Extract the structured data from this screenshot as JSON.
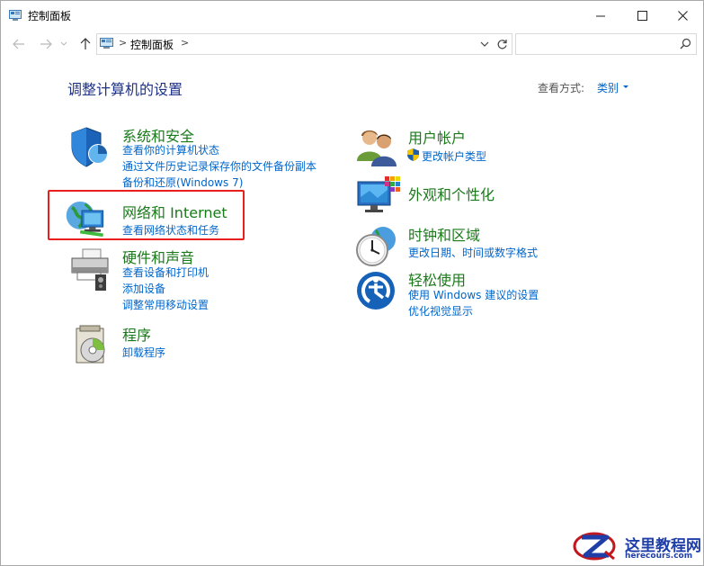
{
  "window": {
    "title": "控制面板",
    "minimize_icon": "minimize-icon",
    "maximize_icon": "maximize-icon",
    "close_icon": "close-icon"
  },
  "nav": {
    "back_icon": "arrow-left-icon",
    "forward_icon": "arrow-right-icon",
    "recent_icon": "chevron-down-icon",
    "up_icon": "arrow-up-icon"
  },
  "address": {
    "separator": ">",
    "path": "控制面板",
    "trailing_separator": ">"
  },
  "search": {
    "placeholder": "",
    "icon": "search-icon"
  },
  "main": {
    "heading": "调整计算机的设置",
    "view_by_label": "查看方式:",
    "view_by_value": "类别"
  },
  "categories_left": [
    {
      "title": "系统和安全",
      "icon": "shield-pie-icon",
      "links": [
        "查看你的计算机状态",
        "通过文件历史记录保存你的文件备份副本",
        "备份和还原(Windows 7)"
      ]
    },
    {
      "title": "网络和 Internet",
      "icon": "network-globe-icon",
      "links": [
        "查看网络状态和任务"
      ]
    },
    {
      "title": "硬件和声音",
      "icon": "printer-speaker-icon",
      "links": [
        "查看设备和打印机",
        "添加设备",
        "调整常用移动设置"
      ]
    },
    {
      "title": "程序",
      "icon": "programs-disc-icon",
      "links": [
        "卸载程序"
      ]
    }
  ],
  "categories_right": [
    {
      "title": "用户帐户",
      "icon": "users-icon",
      "links": [
        "更改帐户类型"
      ]
    },
    {
      "title": "外观和个性化",
      "icon": "monitor-palette-icon",
      "links": []
    },
    {
      "title": "时钟和区域",
      "icon": "clock-globe-icon",
      "links": [
        "更改日期、时间或数字格式"
      ]
    },
    {
      "title": "轻松使用",
      "icon": "ease-of-access-icon",
      "links": [
        "使用 Windows 建议的设置",
        "优化视觉显示"
      ]
    }
  ],
  "watermark": {
    "title": "这里教程网",
    "url": "herecours.com"
  },
  "colors": {
    "heading": "#1e3287",
    "category_title": "#1a7a1a",
    "link": "#0066cc",
    "highlight_box": "#e8201c"
  }
}
